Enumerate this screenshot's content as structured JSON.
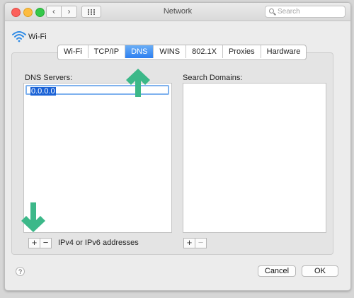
{
  "window": {
    "title": "Network"
  },
  "search": {
    "placeholder": "Search"
  },
  "nav": {
    "back_glyph": "‹",
    "forward_glyph": "›"
  },
  "interface": {
    "name": "Wi-Fi",
    "icon": "wifi-icon"
  },
  "tabs": [
    {
      "label": "Wi-Fi",
      "active": false
    },
    {
      "label": "TCP/IP",
      "active": false
    },
    {
      "label": "DNS",
      "active": true
    },
    {
      "label": "WINS",
      "active": false
    },
    {
      "label": "802.1X",
      "active": false
    },
    {
      "label": "Proxies",
      "active": false
    },
    {
      "label": "Hardware",
      "active": false
    }
  ],
  "dns": {
    "label": "DNS Servers:",
    "servers": [
      "0.0.0.0"
    ],
    "hint": "IPv4 or IPv6 addresses",
    "add_label": "+",
    "remove_label": "−"
  },
  "domains": {
    "label": "Search Domains:",
    "items": [],
    "add_label": "+",
    "remove_label": "−"
  },
  "footer": {
    "help_label": "?",
    "cancel_label": "Cancel",
    "ok_label": "OK"
  },
  "colors": {
    "accent": "#2d7ff0",
    "annotation_arrow": "#3cb889"
  }
}
